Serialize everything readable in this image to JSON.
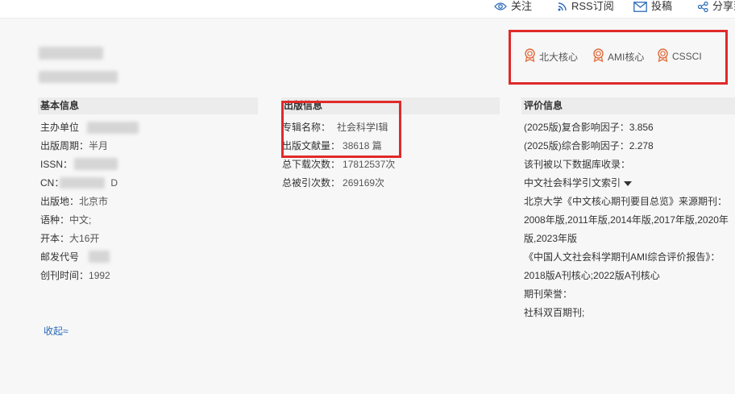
{
  "toolbar": {
    "follow": "关注",
    "rss": "RSS订阅",
    "submit": "投稿",
    "share": "分享到"
  },
  "badges": [
    "北大核心",
    "AMI核心",
    "CSSCI"
  ],
  "basic": {
    "title": "基本信息",
    "rows": [
      {
        "label": "主办单位",
        "value": ""
      },
      {
        "label": "出版周期：",
        "value": "半月"
      },
      {
        "label": "ISSN：",
        "value": ""
      },
      {
        "label": "CN：",
        "value": "D"
      },
      {
        "label": "出版地：",
        "value": "北京市"
      },
      {
        "label": "语种：",
        "value": "中文;"
      },
      {
        "label": "开本：",
        "value": "大16开"
      },
      {
        "label": "邮发代号",
        "value": ""
      },
      {
        "label": "创刊时间：",
        "value": "1992"
      }
    ],
    "collapse": "收起≈"
  },
  "publish": {
    "title": "出版信息",
    "rows": [
      {
        "label": "专辑名称：",
        "value": "社会科学Ⅰ辑"
      },
      {
        "label": "出版文献量：",
        "value": "38618 篇"
      },
      {
        "label": "总下载次数：",
        "value": "17812537次"
      },
      {
        "label": "总被引次数：",
        "value": "269169次"
      }
    ]
  },
  "evaluation": {
    "title": "评价信息",
    "lines": [
      "(2025版)复合影响因子：3.856",
      "(2025版)综合影响因子：2.278",
      "该刊被以下数据库收录：",
      "中文社会科学引文索引",
      "北京大学《中文核心期刊要目总览》来源期刊：",
      "2008年版,2011年版,2014年版,2017年版,2020年",
      "版,2023年版",
      "《中国人文社会科学期刊AMI综合评价报告》：",
      "2018版A刊核心;2022版A刊核心",
      "期刊荣誉：",
      "社科双百期刊;"
    ]
  }
}
